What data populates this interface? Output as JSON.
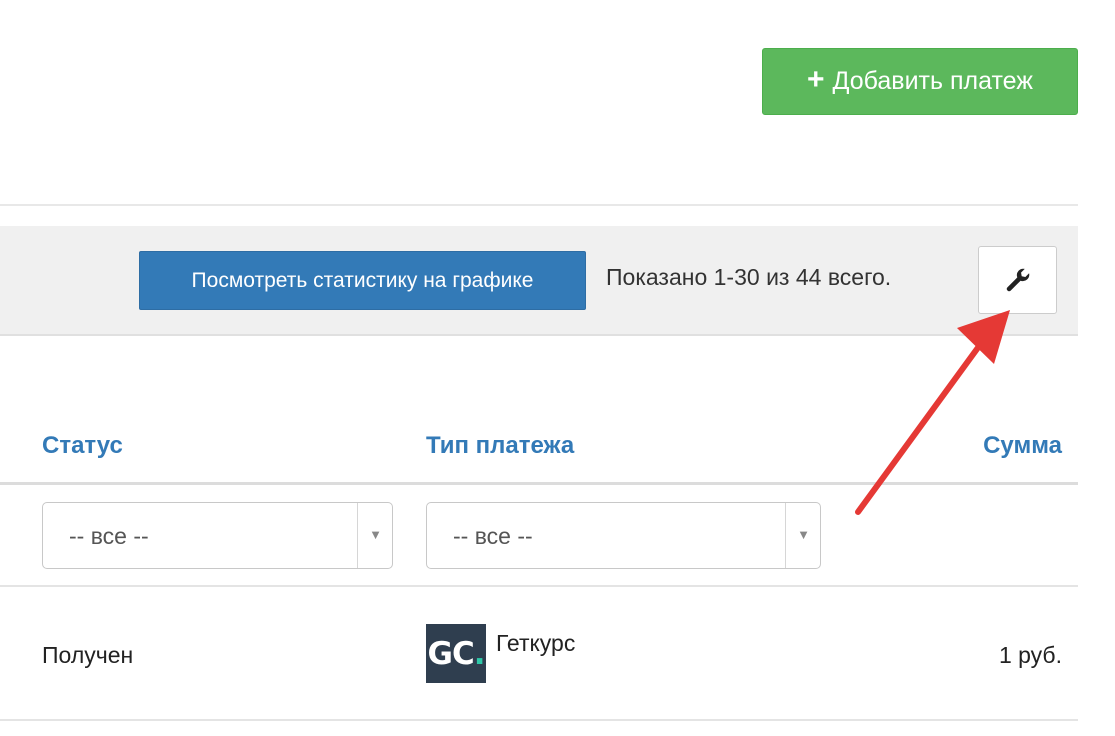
{
  "header": {
    "add_payment_label": "Добавить платеж",
    "add_payment_icon": "plus-icon",
    "add_payment_color": "#5cb85c"
  },
  "toolbar": {
    "stats_button_label": "Посмотреть статистику на графике",
    "stats_button_color": "#337ab7",
    "summary": "Показано 1-30 из 44 всего.",
    "settings_icon": "wrench-icon"
  },
  "table": {
    "columns": [
      {
        "key": "status",
        "label": "Статус"
      },
      {
        "key": "payment_type",
        "label": "Тип платежа"
      },
      {
        "key": "amount",
        "label": "Сумма"
      }
    ],
    "filters": {
      "status": {
        "selected": "-- все --"
      },
      "payment_type": {
        "selected": "-- все --"
      }
    },
    "rows": [
      {
        "status": "Получен",
        "payment_type": "Геткурс",
        "payment_type_logo_text": "GC.",
        "amount": "1 руб."
      }
    ]
  },
  "annotation": {
    "arrow_color": "#e53935",
    "points_to": "wrench-icon"
  }
}
